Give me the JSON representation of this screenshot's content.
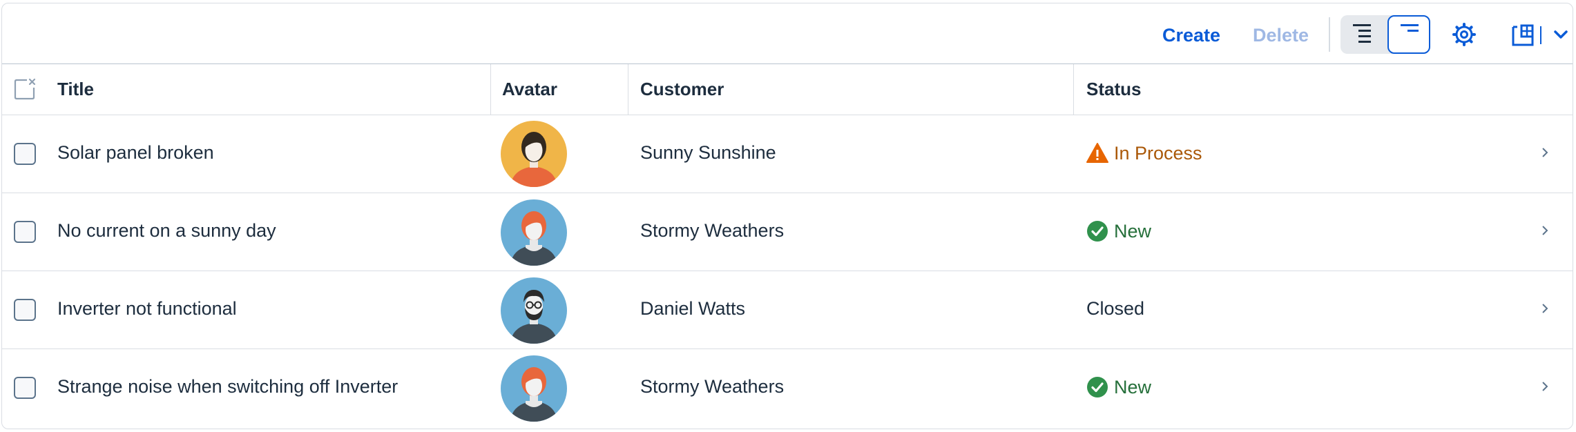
{
  "toolbar": {
    "create_label": "Create",
    "delete_label": "Delete"
  },
  "table": {
    "columns": [
      "Title",
      "Avatar",
      "Customer",
      "Status"
    ],
    "rows": [
      {
        "title": "Solar panel broken",
        "customer": "Sunny Sunshine",
        "status": "In Process",
        "status_type": "warning",
        "avatar": "woman-dark-hair-avatar"
      },
      {
        "title": "No current on a sunny day",
        "customer": "Stormy Weathers",
        "status": "New",
        "status_type": "success",
        "avatar": "woman-red-hair-avatar"
      },
      {
        "title": "Inverter not functional",
        "customer": "Daniel Watts",
        "status": "Closed",
        "status_type": "none",
        "avatar": "man-beard-glasses-avatar"
      },
      {
        "title": "Strange noise when switching off Inverter",
        "customer": "Stormy Weathers",
        "status": "New",
        "status_type": "success",
        "avatar": "woman-red-hair-avatar"
      }
    ]
  },
  "colors": {
    "accent": "#0a5bd7",
    "warning": "#aa5808",
    "warning_icon": "#e76500",
    "success": "#256f3a",
    "success_icon": "#30914c"
  }
}
